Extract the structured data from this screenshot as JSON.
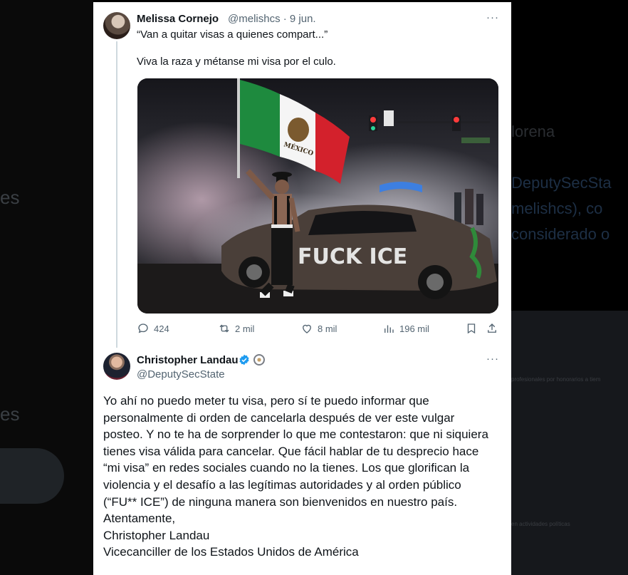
{
  "background": {
    "left_fragments": [
      "es",
      "es"
    ],
    "right_fragments": [
      "lorena",
      "DeputySecSta",
      "melishcs), co",
      "considerado o"
    ],
    "right_small": [
      "profesionales por honorarios a tiem",
      "",
      "",
      "en actividades políticas"
    ]
  },
  "tweet1": {
    "author_name": "Melissa Cornejo",
    "meta": "@melishcs · 9 jun.",
    "quoted_line": "“Van a quitar visas a quienes compart...”",
    "text": "Viva la raza y métanse mi visa por el culo.",
    "photo_caption": "FUCK ICE",
    "flag_text": "MÉXICO",
    "stats": {
      "replies": "424",
      "reposts": "2 mil",
      "likes": "8 mil",
      "views": "196 mil"
    },
    "more_label": "···"
  },
  "tweet2": {
    "author_name": "Christopher Landau",
    "handle": "@DeputySecState",
    "more_label": "···",
    "lines": [
      "Yo ahí no puedo meter tu visa, pero sí te puedo informar que",
      "personalmente di orden de cancelarla después de ver este vulgar",
      "posteo. Y no te ha de sorprender lo que me contestaron: que ni siquiera",
      "tienes visa válida para cancelar. Que fácil hablar de tu desprecio hace",
      "“mi visa” en redes sociales cuando no la tienes. Los que glorifican la",
      "violencia y el desafío a las legítimas autoridades y al orden público",
      "(“FU** ICE”) de ninguna manera son bienvenidos en nuestro país.",
      "Atentamente,",
      "Christopher Landau",
      "Vicecanciller de los Estados Unidos de América"
    ]
  },
  "colors": {
    "text_primary": "#0f1419",
    "text_secondary": "#536471",
    "verified_blue": "#1d9bf0",
    "thread_line": "#cfd9de"
  }
}
